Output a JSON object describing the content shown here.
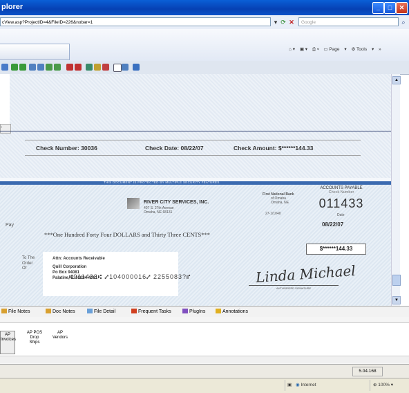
{
  "window": {
    "title": "plorer"
  },
  "address": {
    "url": "cView.asp?ProjectID=4&FileID=226&nobar=1",
    "search_placeholder": "Google"
  },
  "command_bar": {
    "page_label": "Page",
    "tools_label": "Tools"
  },
  "check_stub": {
    "check_number": "Check Number:  30036",
    "check_date": "Check Date: 08/22/07",
    "check_amount": "Check Amount:  $******144.33"
  },
  "check": {
    "payer_name": "RIVER CITY SERVICES, INC.",
    "payer_addr1": "407 S. 27th Avenue",
    "payer_addr2": "Omaha, NE 68131",
    "bank_name": "First National Bank",
    "bank_line2": "of Omaha",
    "bank_line3": "Omaha, NE",
    "routing_frac": "27-1/1040",
    "accounts_payable": "ACCOUNTS PAYABLE",
    "check_number_label": "Check Number",
    "check_number": "011433",
    "date_label": "Date",
    "date": "08/22/07",
    "pay_label": "Pay",
    "amount_words": "***One Hundred Forty Four DOLLARS and Thirty Three CENTS***",
    "amount_box": "$******144.33",
    "to_order_l1": "To The",
    "to_order_l2": "Order",
    "to_order_l3": "Of",
    "attn": "Attn: Accounts Receivable",
    "payee_name": "Quill Corporation",
    "payee_addr1": "Po Box 94081",
    "payee_addr2": "Palatine, IL 60094-4081",
    "signature": "Linda Michael",
    "signature_caption": "AUTHORIZED SIGNATURE",
    "micr": "⑆011433⑆ ⑇104000016⑇  2255083?⑈"
  },
  "tabs": [
    {
      "label": "File Notes",
      "color": "#d8a030"
    },
    {
      "label": "Doc Notes",
      "color": "#d8a030"
    },
    {
      "label": "File Detail",
      "color": "#6aa0d8"
    },
    {
      "label": "Frequent Tasks",
      "color": "#d04020"
    },
    {
      "label": "PlugIns",
      "color": "#8050c0"
    },
    {
      "label": "Annotations",
      "color": "#e0b020"
    }
  ],
  "panel_buttons": [
    {
      "l1": "AP",
      "l2": "Invoices",
      "l3": ""
    },
    {
      "l1": "AP POS",
      "l2": "Drop",
      "l3": "Ships"
    },
    {
      "l1": "AP",
      "l2": "Vendors",
      "l3": ""
    }
  ],
  "status": {
    "version": "5.04.168",
    "zone": "Internet",
    "zoom": "100%"
  }
}
